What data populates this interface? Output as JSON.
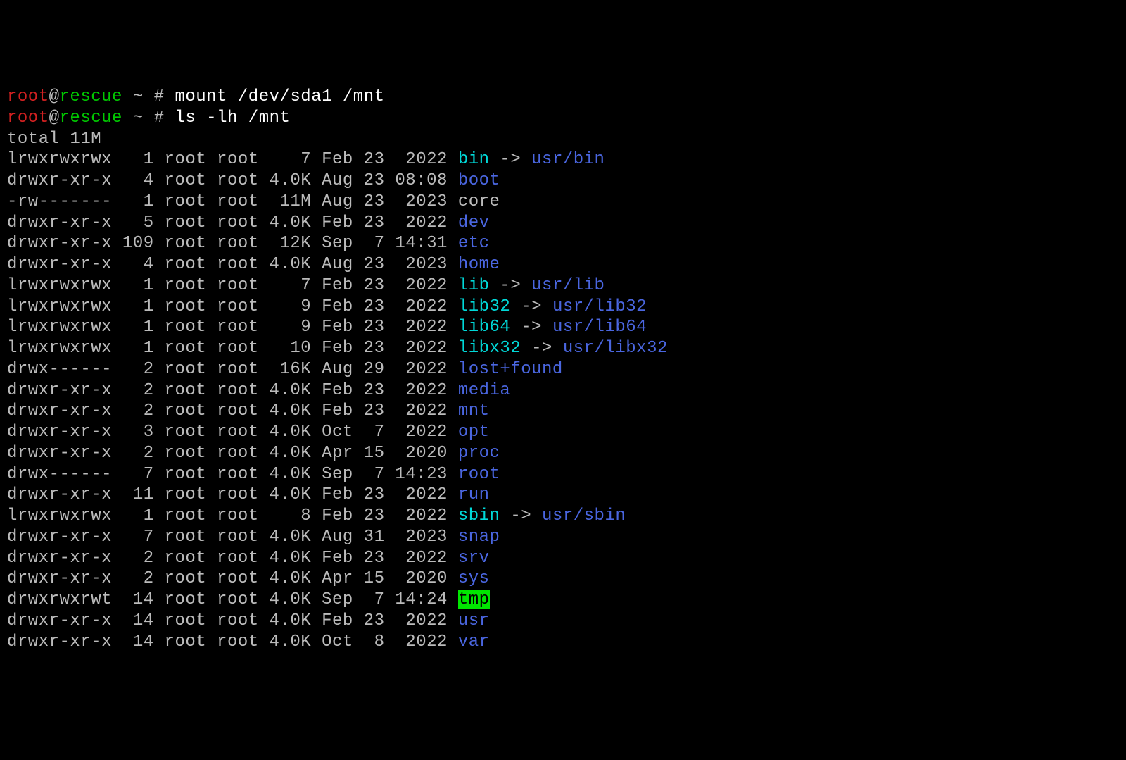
{
  "prompt": {
    "user": "root",
    "at": "@",
    "host": "rescue",
    "cwd": " ~ ",
    "hash": "# "
  },
  "commands": [
    "mount /dev/sda1 /mnt",
    "ls -lh /mnt"
  ],
  "total_line": "total 11M",
  "entries": [
    {
      "perms": "lrwxrwxrwx",
      "links": "  1",
      "owner": "root",
      "group": "root",
      "size": "   7",
      "date": "Feb 23  2022",
      "name": "bin",
      "type": "link",
      "target": "usr/bin"
    },
    {
      "perms": "drwxr-xr-x",
      "links": "  4",
      "owner": "root",
      "group": "root",
      "size": "4.0K",
      "date": "Aug 23 08:08",
      "name": "boot",
      "type": "dir"
    },
    {
      "perms": "-rw-------",
      "links": "  1",
      "owner": "root",
      "group": "root",
      "size": " 11M",
      "date": "Aug 23  2023",
      "name": "core",
      "type": "plain"
    },
    {
      "perms": "drwxr-xr-x",
      "links": "  5",
      "owner": "root",
      "group": "root",
      "size": "4.0K",
      "date": "Feb 23  2022",
      "name": "dev",
      "type": "dir"
    },
    {
      "perms": "drwxr-xr-x",
      "links": "109",
      "owner": "root",
      "group": "root",
      "size": " 12K",
      "date": "Sep  7 14:31",
      "name": "etc",
      "type": "dir"
    },
    {
      "perms": "drwxr-xr-x",
      "links": "  4",
      "owner": "root",
      "group": "root",
      "size": "4.0K",
      "date": "Aug 23  2023",
      "name": "home",
      "type": "dir"
    },
    {
      "perms": "lrwxrwxrwx",
      "links": "  1",
      "owner": "root",
      "group": "root",
      "size": "   7",
      "date": "Feb 23  2022",
      "name": "lib",
      "type": "link",
      "target": "usr/lib"
    },
    {
      "perms": "lrwxrwxrwx",
      "links": "  1",
      "owner": "root",
      "group": "root",
      "size": "   9",
      "date": "Feb 23  2022",
      "name": "lib32",
      "type": "link",
      "target": "usr/lib32"
    },
    {
      "perms": "lrwxrwxrwx",
      "links": "  1",
      "owner": "root",
      "group": "root",
      "size": "   9",
      "date": "Feb 23  2022",
      "name": "lib64",
      "type": "link",
      "target": "usr/lib64"
    },
    {
      "perms": "lrwxrwxrwx",
      "links": "  1",
      "owner": "root",
      "group": "root",
      "size": "  10",
      "date": "Feb 23  2022",
      "name": "libx32",
      "type": "link",
      "target": "usr/libx32"
    },
    {
      "perms": "drwx------",
      "links": "  2",
      "owner": "root",
      "group": "root",
      "size": " 16K",
      "date": "Aug 29  2022",
      "name": "lost+found",
      "type": "dir"
    },
    {
      "perms": "drwxr-xr-x",
      "links": "  2",
      "owner": "root",
      "group": "root",
      "size": "4.0K",
      "date": "Feb 23  2022",
      "name": "media",
      "type": "dir"
    },
    {
      "perms": "drwxr-xr-x",
      "links": "  2",
      "owner": "root",
      "group": "root",
      "size": "4.0K",
      "date": "Feb 23  2022",
      "name": "mnt",
      "type": "dir"
    },
    {
      "perms": "drwxr-xr-x",
      "links": "  3",
      "owner": "root",
      "group": "root",
      "size": "4.0K",
      "date": "Oct  7  2022",
      "name": "opt",
      "type": "dir"
    },
    {
      "perms": "drwxr-xr-x",
      "links": "  2",
      "owner": "root",
      "group": "root",
      "size": "4.0K",
      "date": "Apr 15  2020",
      "name": "proc",
      "type": "dir"
    },
    {
      "perms": "drwx------",
      "links": "  7",
      "owner": "root",
      "group": "root",
      "size": "4.0K",
      "date": "Sep  7 14:23",
      "name": "root",
      "type": "dir"
    },
    {
      "perms": "drwxr-xr-x",
      "links": " 11",
      "owner": "root",
      "group": "root",
      "size": "4.0K",
      "date": "Feb 23  2022",
      "name": "run",
      "type": "dir"
    },
    {
      "perms": "lrwxrwxrwx",
      "links": "  1",
      "owner": "root",
      "group": "root",
      "size": "   8",
      "date": "Feb 23  2022",
      "name": "sbin",
      "type": "link",
      "target": "usr/sbin"
    },
    {
      "perms": "drwxr-xr-x",
      "links": "  7",
      "owner": "root",
      "group": "root",
      "size": "4.0K",
      "date": "Aug 31  2023",
      "name": "snap",
      "type": "dir"
    },
    {
      "perms": "drwxr-xr-x",
      "links": "  2",
      "owner": "root",
      "group": "root",
      "size": "4.0K",
      "date": "Feb 23  2022",
      "name": "srv",
      "type": "dir"
    },
    {
      "perms": "drwxr-xr-x",
      "links": "  2",
      "owner": "root",
      "group": "root",
      "size": "4.0K",
      "date": "Apr 15  2020",
      "name": "sys",
      "type": "dir"
    },
    {
      "perms": "drwxrwxrwt",
      "links": " 14",
      "owner": "root",
      "group": "root",
      "size": "4.0K",
      "date": "Sep  7 14:24",
      "name": "tmp",
      "type": "sticky"
    },
    {
      "perms": "drwxr-xr-x",
      "links": " 14",
      "owner": "root",
      "group": "root",
      "size": "4.0K",
      "date": "Feb 23  2022",
      "name": "usr",
      "type": "dir"
    },
    {
      "perms": "drwxr-xr-x",
      "links": " 14",
      "owner": "root",
      "group": "root",
      "size": "4.0K",
      "date": "Oct  8  2022",
      "name": "var",
      "type": "dir"
    }
  ]
}
